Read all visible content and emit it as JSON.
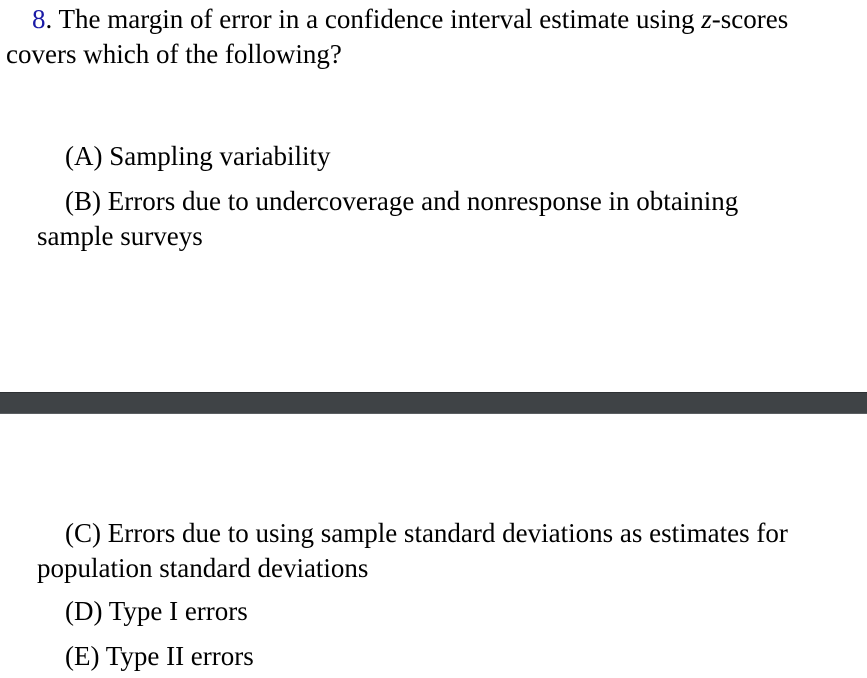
{
  "question": {
    "number": "8",
    "line1_before_z": ". The margin of error in a confidence interval estimate using ",
    "z_variable": "z",
    "line1_after_z": "-scores",
    "line2": "covers which of the following?"
  },
  "options": {
    "a": {
      "line1": "(A) Sampling variability"
    },
    "b": {
      "line1": "(B) Errors due to undercoverage and nonresponse in obtaining",
      "line2": "sample surveys"
    },
    "c": {
      "line1": "(C) Errors due to using sample standard deviations as estimates for",
      "line2": "population standard deviations"
    },
    "d": {
      "line1": "(D) Type I errors"
    },
    "e": {
      "line1": "(E) Type II errors"
    }
  },
  "colors": {
    "question_number": "#1a1aa6",
    "page_break_bar": "#3f4346"
  }
}
